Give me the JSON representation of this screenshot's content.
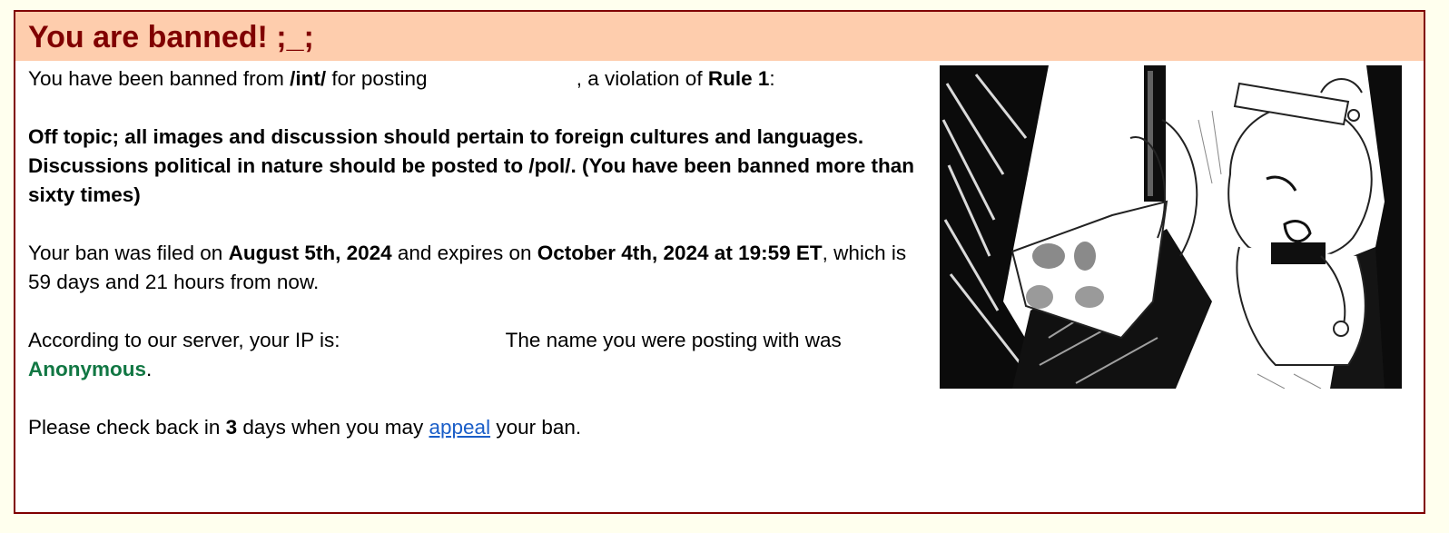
{
  "title": "You are banned! ;_;",
  "intro": {
    "prefix": "You have been banned from ",
    "board": "/int/",
    "middle": " for posting ",
    "post_link": "",
    "violation_text": ", a violation of ",
    "rule": "Rule 1",
    "colon": ":"
  },
  "reason": "Off topic; all images and discussion should pertain to foreign cultures and languages. Discussions political in nature should be posted to /pol/. (You have been banned more than sixty times)",
  "dates": {
    "filed_prefix": "Your ban was filed on ",
    "filed_date": "August 5th, 2024",
    "expires_prefix": " and expires on ",
    "expires_date": "October 4th, 2024 at 19:59 ET",
    "comma": ",",
    "remaining": " which is 59 days and 21 hours from now."
  },
  "ip_info": {
    "ip_prefix": "According to our server, your IP is:",
    "ip_value": "",
    "name_prefix": "The name you were posting with was ",
    "name": "Anonymous",
    "period": "."
  },
  "appeal": {
    "prefix": "Please check back in ",
    "days": "3",
    "middle": " days when you may ",
    "link": "appeal",
    "suffix": " your ban."
  },
  "colors": {
    "page_background": "#ffffee",
    "header_background": "#fecdad",
    "title_color": "#800000",
    "border_color": "#800000",
    "name_color": "#117743",
    "link_color": "#1a5ec8"
  },
  "image": {
    "description_icon": "ban-illustration-manga-sketch"
  }
}
